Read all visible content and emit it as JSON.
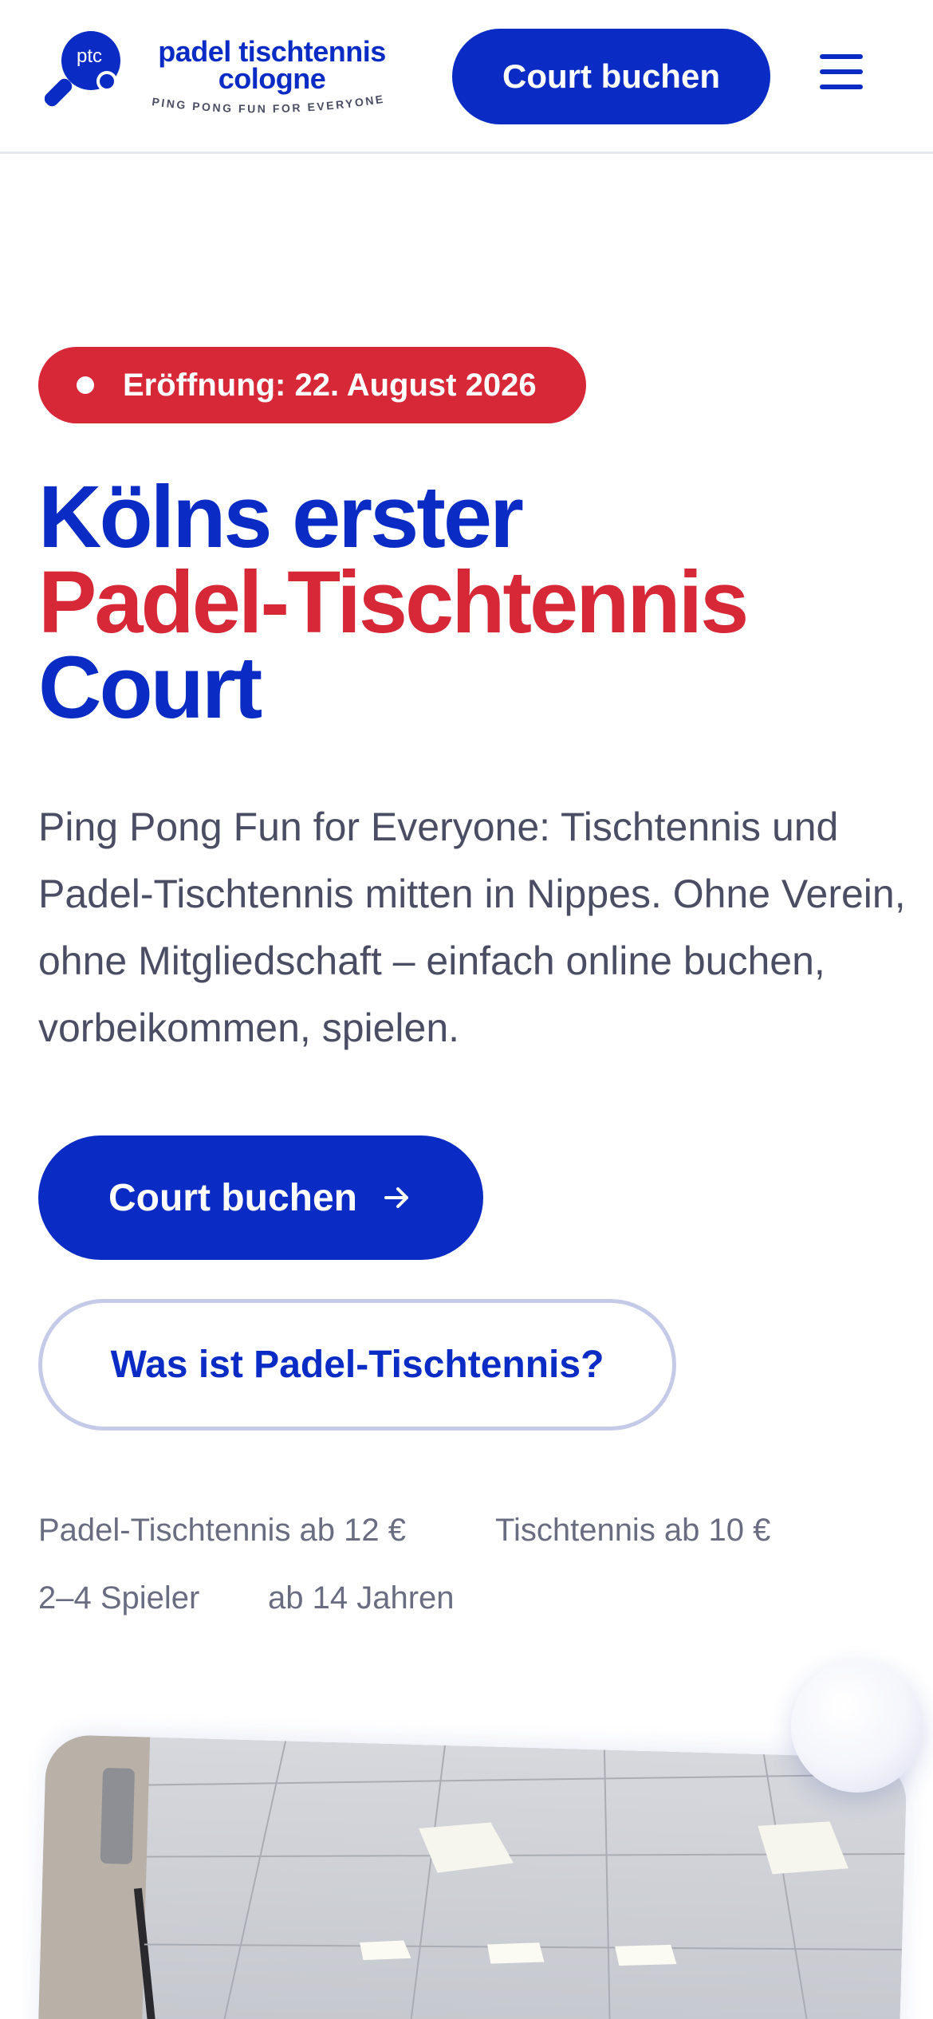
{
  "header": {
    "logo": {
      "mark_text": "ptc",
      "title_line1": "padel tischtennis",
      "title_line2": "cologne",
      "tagline": "PING PONG FUN FOR EVERYONE"
    },
    "cta_label": "Court buchen",
    "menu_icon": "hamburger-menu-icon"
  },
  "hero": {
    "badge": "Eröffnung: 22. August 2026",
    "headline": {
      "line1": "Kölns erster",
      "line2": "Padel-Tischtennis",
      "line3": "Court"
    },
    "intro": "Ping Pong Fun for Everyone: Tischtennis und Padel-Tischtennis mitten in Nippes. Ohne Verein, ohne Mitgliedschaft – einfach online buchen, vorbeikommen, spielen.",
    "primary_cta": "Court buchen",
    "primary_cta_icon": "arrow-right-icon",
    "secondary_cta": "Was ist Padel-Tischtennis?",
    "facts": {
      "padel_price": "Padel-Tischtennis ab 12 €",
      "tt_price": "Tischtennis ab 10 €",
      "players": "2–4 Spieler",
      "age": "ab 14 Jahren"
    }
  },
  "colors": {
    "brand_blue": "#0a2cc4",
    "accent_red": "#d62837",
    "text_gray": "#4a4d63"
  }
}
